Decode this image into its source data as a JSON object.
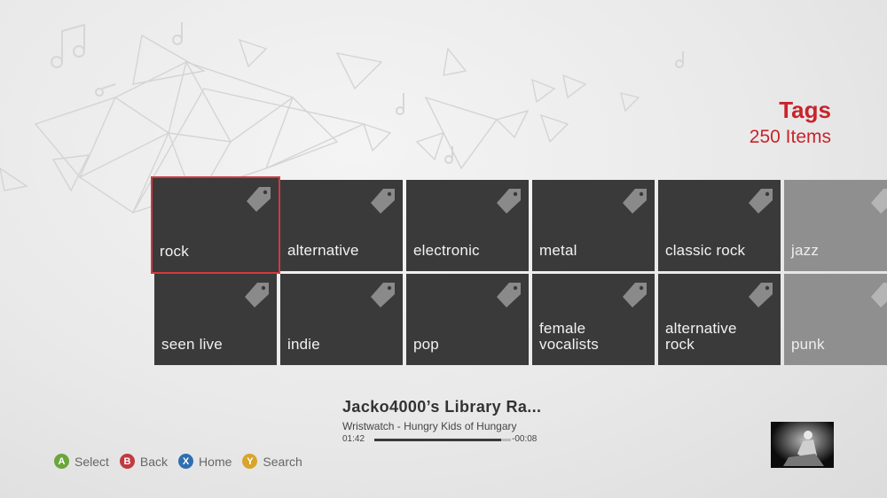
{
  "header": {
    "title": "Tags",
    "count": "250 Items"
  },
  "tiles_row1": [
    "rock",
    "alternative",
    "electronic",
    "metal",
    "classic rock",
    "jazz"
  ],
  "tiles_row2": [
    "seen live",
    "indie",
    "pop",
    "female\nvocalists",
    "alternative\nrock",
    "punk"
  ],
  "now_playing": {
    "station": "Jacko4000’s Library Ra...",
    "track": "Wristwatch - Hungry Kids of Hungary",
    "elapsed": "01:42",
    "remaining": "-00:08",
    "progress": 0.93
  },
  "controls": [
    {
      "key": "A",
      "label": "Select",
      "color": "#6aa63c"
    },
    {
      "key": "B",
      "label": "Back",
      "color": "#c13a3f"
    },
    {
      "key": "X",
      "label": "Home",
      "color": "#2f6fb0"
    },
    {
      "key": "Y",
      "label": "Search",
      "color": "#d7a52a"
    }
  ]
}
